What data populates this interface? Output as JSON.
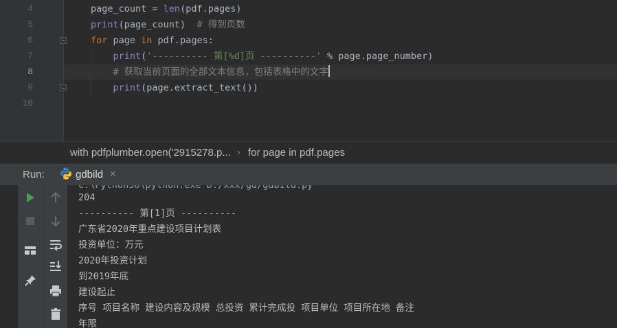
{
  "editor": {
    "gutter_line_numbers": [
      "4",
      "5",
      "6",
      "7",
      "8",
      "9",
      "10"
    ],
    "active_line": "8",
    "lines": [
      {
        "segments": [
          {
            "t": "page_count = ",
            "c": "plain"
          },
          {
            "t": "len",
            "c": "builtin"
          },
          {
            "t": "(pdf.pages)",
            "c": "plain"
          }
        ]
      },
      {
        "segments": [
          {
            "t": "print",
            "c": "builtin"
          },
          {
            "t": "(page_count)  ",
            "c": "plain"
          },
          {
            "t": "# 得到页数",
            "c": "comment"
          }
        ]
      },
      {
        "segments": [
          {
            "t": "for ",
            "c": "keyword"
          },
          {
            "t": "page ",
            "c": "plain"
          },
          {
            "t": "in ",
            "c": "keyword"
          },
          {
            "t": "pdf.pages:",
            "c": "plain"
          }
        ]
      },
      {
        "segments": [
          {
            "t": "    print",
            "c": "builtin"
          },
          {
            "t": "(",
            "c": "plain"
          },
          {
            "t": "'---------- 第[%d]页 ----------'",
            "c": "string"
          },
          {
            "t": " % page.page_number)",
            "c": "plain"
          }
        ]
      },
      {
        "segments": [
          {
            "t": "    # 获取当前页面的全部文本信息，包括表格中的文字",
            "c": "comment"
          }
        ]
      },
      {
        "segments": [
          {
            "t": "    print",
            "c": "builtin"
          },
          {
            "t": "(page.extract_text())",
            "c": "plain"
          }
        ]
      },
      {
        "segments": []
      }
    ]
  },
  "breadcrumb": {
    "items": [
      "with pdfplumber.open('2915278.p...",
      "for page in pdf.pages"
    ],
    "separator": "›"
  },
  "run_panel": {
    "label": "Run:",
    "tab_label": "gdbild",
    "tab_icon": "python-icon",
    "close_glyph": "×"
  },
  "toolbar": {
    "left": [
      "run-icon",
      "stop-icon",
      "layout-icon",
      "pin-icon"
    ],
    "right": [
      "scroll-up-icon",
      "scroll-down-icon",
      "soft-wrap-icon",
      "scroll-to-end-icon",
      "print-icon",
      "trash-icon"
    ]
  },
  "console": {
    "lines": [
      "204",
      "---------- 第[1]页 ----------",
      "广东省2020年重点建设项目计划表",
      "投资单位：万元",
      "2020年投资计划",
      "到2019年底",
      "建设起止",
      "序号 项目名称 建设内容及规模 总投资 累计完成投 项目单位 项目所在地 备注",
      "年限"
    ]
  },
  "colors": {
    "background": "#2b2b2b",
    "keyword": "#cc7832",
    "builtin": "#8888c6",
    "string": "#6a8759",
    "comment": "#808080",
    "plain": "#a9b7c6",
    "run_green": "#499c54"
  }
}
